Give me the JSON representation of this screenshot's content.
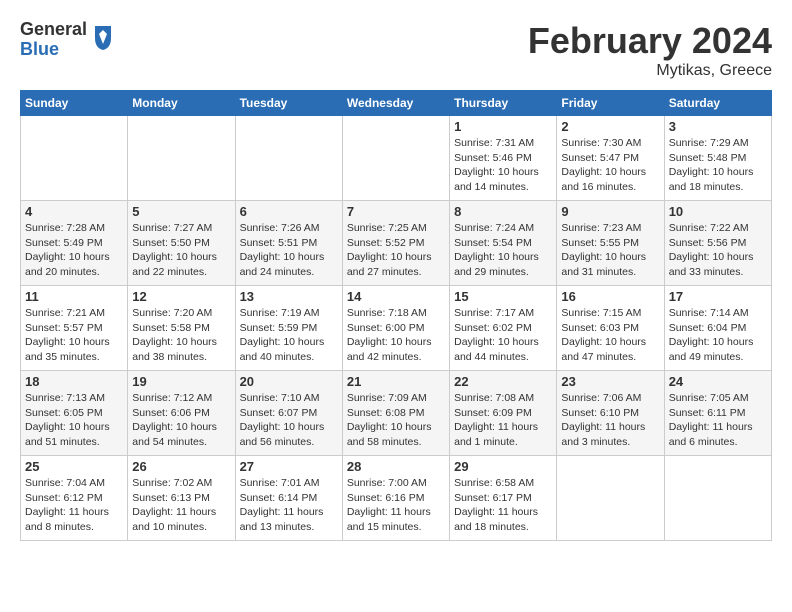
{
  "header": {
    "logo_general": "General",
    "logo_blue": "Blue",
    "month_title": "February 2024",
    "location": "Mytikas, Greece"
  },
  "days_of_week": [
    "Sunday",
    "Monday",
    "Tuesday",
    "Wednesday",
    "Thursday",
    "Friday",
    "Saturday"
  ],
  "weeks": [
    {
      "days": [
        {
          "number": "",
          "info": "",
          "empty": true
        },
        {
          "number": "",
          "info": "",
          "empty": true
        },
        {
          "number": "",
          "info": "",
          "empty": true
        },
        {
          "number": "",
          "info": "",
          "empty": true
        },
        {
          "number": "1",
          "info": "Sunrise: 7:31 AM\nSunset: 5:46 PM\nDaylight: 10 hours\nand 14 minutes.",
          "empty": false
        },
        {
          "number": "2",
          "info": "Sunrise: 7:30 AM\nSunset: 5:47 PM\nDaylight: 10 hours\nand 16 minutes.",
          "empty": false
        },
        {
          "number": "3",
          "info": "Sunrise: 7:29 AM\nSunset: 5:48 PM\nDaylight: 10 hours\nand 18 minutes.",
          "empty": false
        }
      ]
    },
    {
      "days": [
        {
          "number": "4",
          "info": "Sunrise: 7:28 AM\nSunset: 5:49 PM\nDaylight: 10 hours\nand 20 minutes.",
          "empty": false
        },
        {
          "number": "5",
          "info": "Sunrise: 7:27 AM\nSunset: 5:50 PM\nDaylight: 10 hours\nand 22 minutes.",
          "empty": false
        },
        {
          "number": "6",
          "info": "Sunrise: 7:26 AM\nSunset: 5:51 PM\nDaylight: 10 hours\nand 24 minutes.",
          "empty": false
        },
        {
          "number": "7",
          "info": "Sunrise: 7:25 AM\nSunset: 5:52 PM\nDaylight: 10 hours\nand 27 minutes.",
          "empty": false
        },
        {
          "number": "8",
          "info": "Sunrise: 7:24 AM\nSunset: 5:54 PM\nDaylight: 10 hours\nand 29 minutes.",
          "empty": false
        },
        {
          "number": "9",
          "info": "Sunrise: 7:23 AM\nSunset: 5:55 PM\nDaylight: 10 hours\nand 31 minutes.",
          "empty": false
        },
        {
          "number": "10",
          "info": "Sunrise: 7:22 AM\nSunset: 5:56 PM\nDaylight: 10 hours\nand 33 minutes.",
          "empty": false
        }
      ]
    },
    {
      "days": [
        {
          "number": "11",
          "info": "Sunrise: 7:21 AM\nSunset: 5:57 PM\nDaylight: 10 hours\nand 35 minutes.",
          "empty": false
        },
        {
          "number": "12",
          "info": "Sunrise: 7:20 AM\nSunset: 5:58 PM\nDaylight: 10 hours\nand 38 minutes.",
          "empty": false
        },
        {
          "number": "13",
          "info": "Sunrise: 7:19 AM\nSunset: 5:59 PM\nDaylight: 10 hours\nand 40 minutes.",
          "empty": false
        },
        {
          "number": "14",
          "info": "Sunrise: 7:18 AM\nSunset: 6:00 PM\nDaylight: 10 hours\nand 42 minutes.",
          "empty": false
        },
        {
          "number": "15",
          "info": "Sunrise: 7:17 AM\nSunset: 6:02 PM\nDaylight: 10 hours\nand 44 minutes.",
          "empty": false
        },
        {
          "number": "16",
          "info": "Sunrise: 7:15 AM\nSunset: 6:03 PM\nDaylight: 10 hours\nand 47 minutes.",
          "empty": false
        },
        {
          "number": "17",
          "info": "Sunrise: 7:14 AM\nSunset: 6:04 PM\nDaylight: 10 hours\nand 49 minutes.",
          "empty": false
        }
      ]
    },
    {
      "days": [
        {
          "number": "18",
          "info": "Sunrise: 7:13 AM\nSunset: 6:05 PM\nDaylight: 10 hours\nand 51 minutes.",
          "empty": false
        },
        {
          "number": "19",
          "info": "Sunrise: 7:12 AM\nSunset: 6:06 PM\nDaylight: 10 hours\nand 54 minutes.",
          "empty": false
        },
        {
          "number": "20",
          "info": "Sunrise: 7:10 AM\nSunset: 6:07 PM\nDaylight: 10 hours\nand 56 minutes.",
          "empty": false
        },
        {
          "number": "21",
          "info": "Sunrise: 7:09 AM\nSunset: 6:08 PM\nDaylight: 10 hours\nand 58 minutes.",
          "empty": false
        },
        {
          "number": "22",
          "info": "Sunrise: 7:08 AM\nSunset: 6:09 PM\nDaylight: 11 hours\nand 1 minute.",
          "empty": false
        },
        {
          "number": "23",
          "info": "Sunrise: 7:06 AM\nSunset: 6:10 PM\nDaylight: 11 hours\nand 3 minutes.",
          "empty": false
        },
        {
          "number": "24",
          "info": "Sunrise: 7:05 AM\nSunset: 6:11 PM\nDaylight: 11 hours\nand 6 minutes.",
          "empty": false
        }
      ]
    },
    {
      "days": [
        {
          "number": "25",
          "info": "Sunrise: 7:04 AM\nSunset: 6:12 PM\nDaylight: 11 hours\nand 8 minutes.",
          "empty": false
        },
        {
          "number": "26",
          "info": "Sunrise: 7:02 AM\nSunset: 6:13 PM\nDaylight: 11 hours\nand 10 minutes.",
          "empty": false
        },
        {
          "number": "27",
          "info": "Sunrise: 7:01 AM\nSunset: 6:14 PM\nDaylight: 11 hours\nand 13 minutes.",
          "empty": false
        },
        {
          "number": "28",
          "info": "Sunrise: 7:00 AM\nSunset: 6:16 PM\nDaylight: 11 hours\nand 15 minutes.",
          "empty": false
        },
        {
          "number": "29",
          "info": "Sunrise: 6:58 AM\nSunset: 6:17 PM\nDaylight: 11 hours\nand 18 minutes.",
          "empty": false
        },
        {
          "number": "",
          "info": "",
          "empty": true
        },
        {
          "number": "",
          "info": "",
          "empty": true
        }
      ]
    }
  ]
}
